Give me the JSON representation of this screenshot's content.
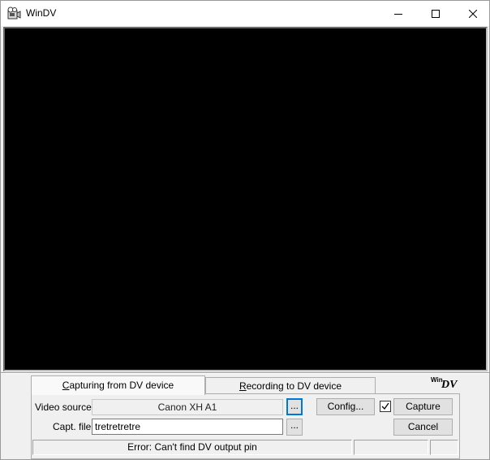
{
  "window": {
    "title": "WinDV",
    "app_icon": "camcorder-icon",
    "controls": [
      "minimize-icon",
      "maximize-icon",
      "close-icon"
    ]
  },
  "tabs": [
    {
      "label": "Capturing from DV device",
      "mnemonic": "C",
      "rest": "apturing from DV device",
      "active": true
    },
    {
      "label": "Recording to DV device",
      "mnemonic": "R",
      "rest": "ecording to DV device",
      "active": false
    }
  ],
  "logo": {
    "prefix": "Win",
    "suffix": "DV"
  },
  "form": {
    "video_source_label": "Video source:",
    "video_source_value": "Canon XH A1",
    "capt_file_label": "Capt. file:",
    "capt_file_value": "tretretretre",
    "browse_label": "...",
    "config_label": "Config...",
    "capture_checked": true,
    "capture_label": "Capture",
    "cancel_label": "Cancel"
  },
  "status": {
    "message": "Error: Can't find DV output pin",
    "panel2": "",
    "panel3": ""
  },
  "colors": {
    "video_background": "#000000",
    "focus_border": "#0078d7"
  }
}
